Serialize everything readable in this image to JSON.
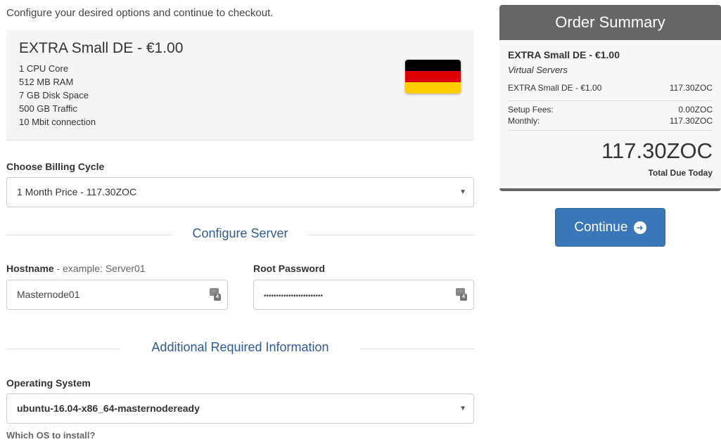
{
  "intro": "Configure your desired options and continue to checkout.",
  "product": {
    "name": "EXTRA Small DE - €1.00",
    "features": [
      "1 CPU Core",
      "512 MB RAM",
      "7 GB Disk Space",
      "500 GB Traffic",
      "10 Mbit connection"
    ],
    "flag_colors": [
      "#000000",
      "#dd0000",
      "#ffce00"
    ]
  },
  "billing": {
    "label": "Choose Billing Cycle",
    "selected": "1 Month Price - 117.30ZOC"
  },
  "configure_server": {
    "heading": "Configure Server",
    "hostname_label": "Hostname",
    "hostname_hint": " - example: Server01",
    "hostname_value": "Masternode01",
    "password_label": "Root Password",
    "password_value": "••••••••••••••••••••••••"
  },
  "additional": {
    "heading": "Additional Required Information",
    "os_label": "Operating System",
    "os_selected": "ubuntu-16.04-x86_64-masternodeready",
    "os_help": "Which OS to install?"
  },
  "summary": {
    "title": "Order Summary",
    "product": "EXTRA Small DE - €1.00",
    "group": "Virtual Servers",
    "line_item": "EXTRA Small DE - €1.00",
    "line_price": "117.30ZOC",
    "setup_label": "Setup Fees:",
    "setup_value": "0.00ZOC",
    "monthly_label": "Monthly:",
    "monthly_value": "117.30ZOC",
    "total": "117.30ZOC",
    "total_label": "Total Due Today"
  },
  "continue_label": "Continue",
  "colors": {
    "accent": "#3a77b8",
    "heading": "#2f5b8f",
    "summary_header": "#666666"
  }
}
